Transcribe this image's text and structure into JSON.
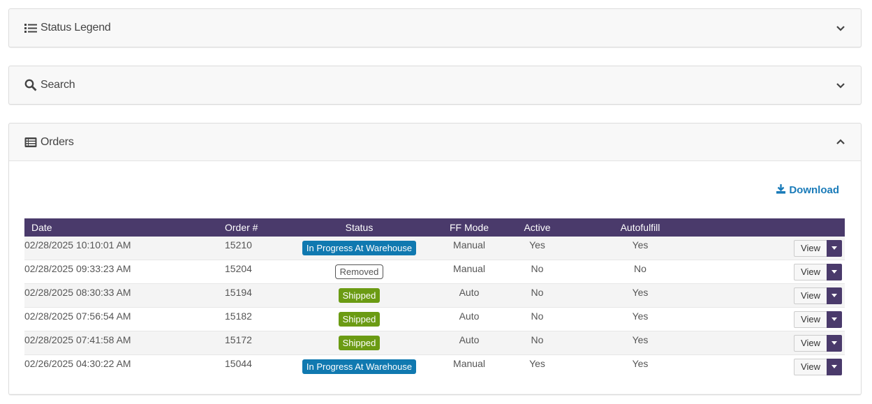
{
  "panels": {
    "legend": {
      "title": "Status Legend"
    },
    "search": {
      "title": "Search"
    },
    "orders": {
      "title": "Orders",
      "download_label": "Download"
    }
  },
  "table": {
    "headers": {
      "date": "Date",
      "order": "Order #",
      "status": "Status",
      "ff_mode": "FF Mode",
      "active": "Active",
      "autofulfill": "Autofulfill"
    },
    "rows": [
      {
        "date": "02/28/2025 10:10:01 AM",
        "order": "15210",
        "status": "In Progress At Warehouse",
        "ff_mode": "Manual",
        "active": "Yes",
        "autofulfill": "Yes",
        "action": "View"
      },
      {
        "date": "02/28/2025 09:33:23 AM",
        "order": "15204",
        "status": "Removed",
        "ff_mode": "Manual",
        "active": "No",
        "autofulfill": "No",
        "action": "View"
      },
      {
        "date": "02/28/2025 08:30:33 AM",
        "order": "15194",
        "status": "Shipped",
        "ff_mode": "Auto",
        "active": "No",
        "autofulfill": "Yes",
        "action": "View"
      },
      {
        "date": "02/28/2025 07:56:54 AM",
        "order": "15182",
        "status": "Shipped",
        "ff_mode": "Auto",
        "active": "No",
        "autofulfill": "Yes",
        "action": "View"
      },
      {
        "date": "02/28/2025 07:41:58 AM",
        "order": "15172",
        "status": "Shipped",
        "ff_mode": "Auto",
        "active": "No",
        "autofulfill": "Yes",
        "action": "View"
      },
      {
        "date": "02/26/2025 04:30:22 AM",
        "order": "15044",
        "status": "In Progress At Warehouse",
        "ff_mode": "Manual",
        "active": "Yes",
        "autofulfill": "Yes",
        "action": "View"
      }
    ]
  },
  "colors": {
    "header_bg": "#4a3a6b",
    "in_progress": "#1079b0",
    "shipped": "#6b9b13",
    "download": "#1a7bb9"
  },
  "icons": {
    "legend": "list-icon",
    "search": "search-icon",
    "orders": "table-list-icon",
    "download": "download-icon"
  }
}
